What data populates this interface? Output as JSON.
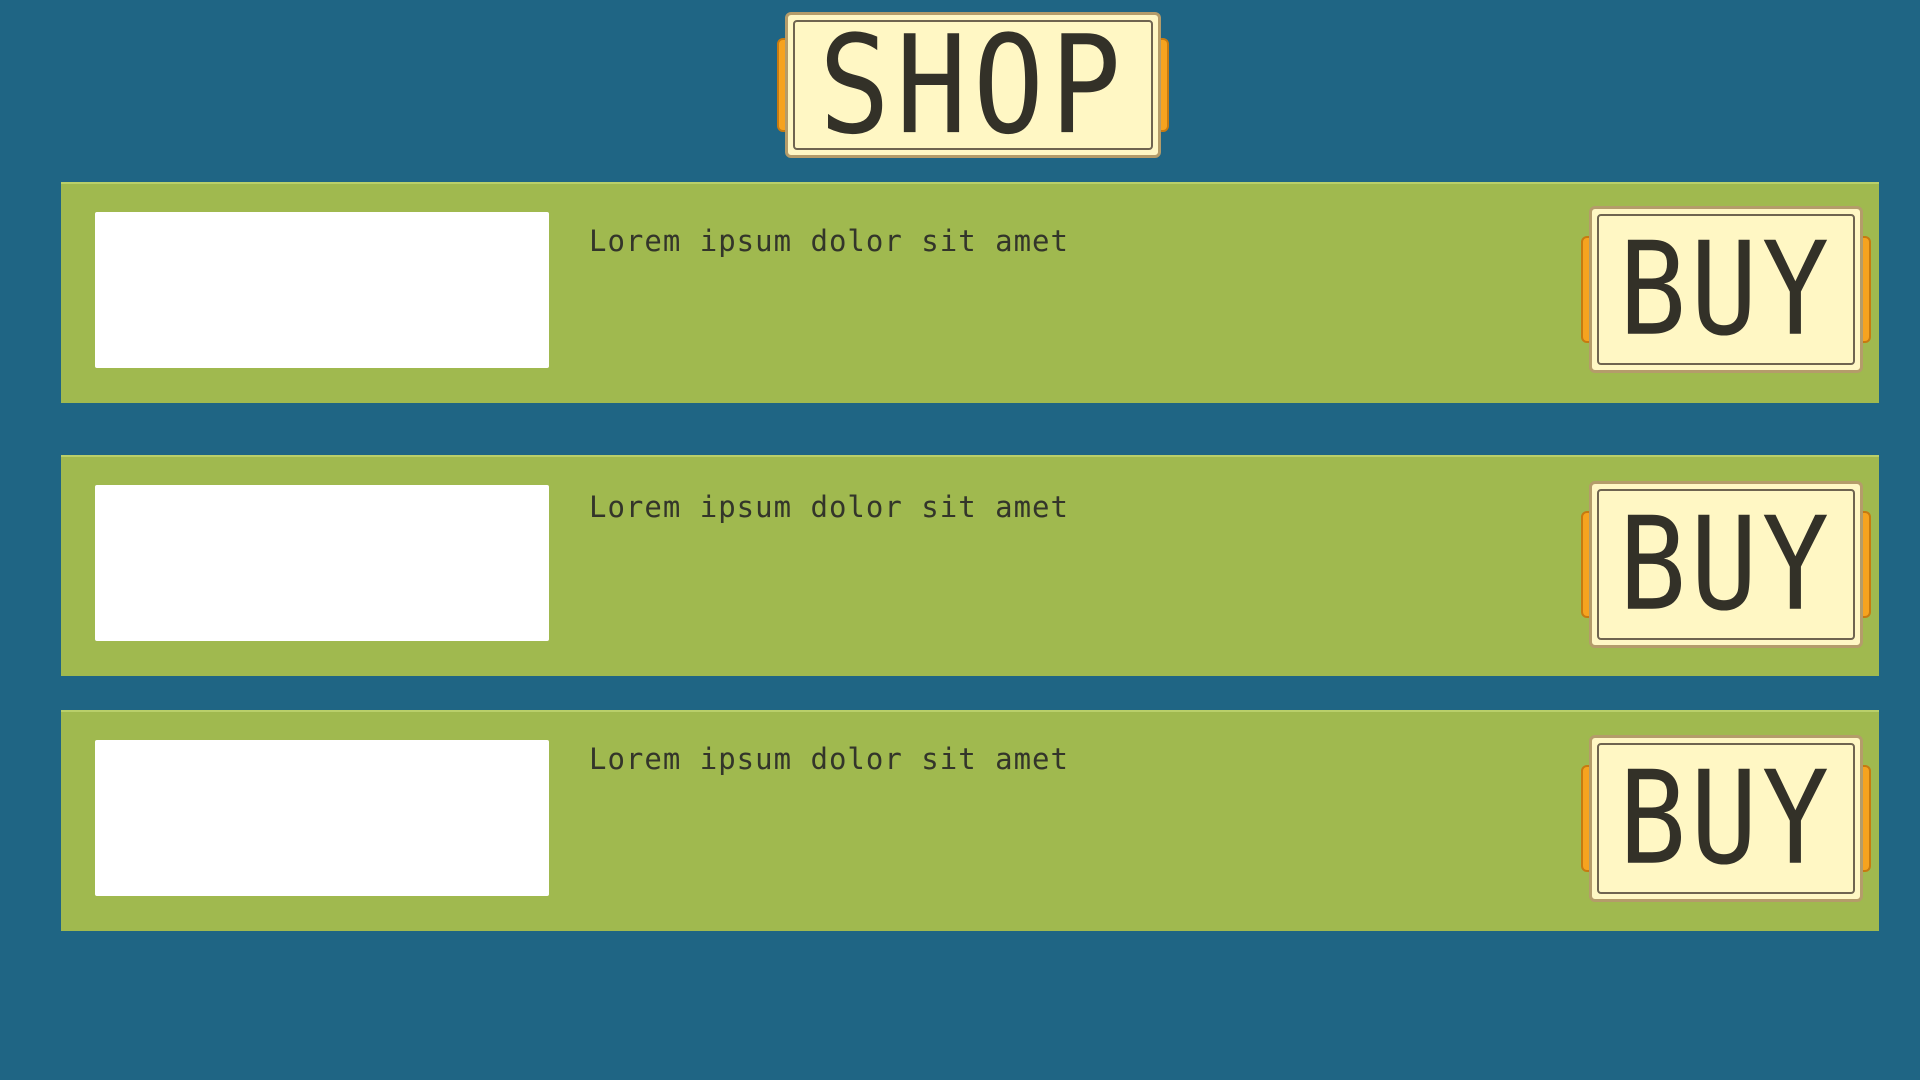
{
  "title": "SHOP",
  "items": [
    {
      "description": "Lorem ipsum dolor sit amet",
      "buy_label": "BUY"
    },
    {
      "description": "Lorem ipsum dolor sit amet",
      "buy_label": "BUY"
    },
    {
      "description": "Lorem ipsum dolor sit amet",
      "buy_label": "BUY"
    }
  ],
  "colors": {
    "background": "#1f6584",
    "row": "#a0b94f",
    "plaque": "#fff7c4",
    "plaque_cap": "#f6a31f",
    "text": "#333128"
  }
}
